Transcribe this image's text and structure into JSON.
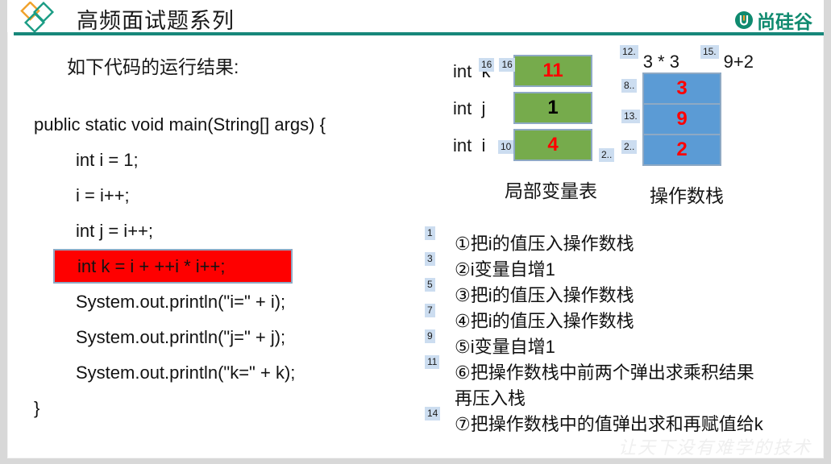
{
  "header": {
    "title": "高频面试题系列",
    "brand_text": "尚硅谷",
    "logo_icon": "diamonds-logo-icon",
    "brand_icon": "shangguigu-u-logo-icon",
    "rule_color": "#17877a",
    "brand_color": "#0f8a6f"
  },
  "left": {
    "lead": "如下代码的运行结果:",
    "code": [
      {
        "text": "public static void main(String[] args) {",
        "indent": false,
        "highlight": false
      },
      {
        "text": "int i = 1;",
        "indent": true,
        "highlight": false
      },
      {
        "text": "i = i++;",
        "indent": true,
        "highlight": false
      },
      {
        "text": "int j = i++;",
        "indent": true,
        "highlight": false
      },
      {
        "text": "int k = i + ++i * i++;",
        "indent": true,
        "highlight": true
      },
      {
        "text": "System.out.println(\"i=\" + i);",
        "indent": true,
        "highlight": false
      },
      {
        "text": "System.out.println(\"j=\" + j);",
        "indent": true,
        "highlight": false
      },
      {
        "text": "System.out.println(\"k=\" + k);",
        "indent": true,
        "highlight": false
      },
      {
        "text": "}",
        "indent": false,
        "highlight": false
      }
    ],
    "highlight_bg": "#fe0000",
    "highlight_border": "#8ea9c4"
  },
  "local_variable_table": {
    "caption": "局部变量表",
    "box_color": "#76ab4c",
    "border_color": "#8ea9c4",
    "rows": [
      {
        "type": "int",
        "name": "k",
        "badges": [
          "16",
          "16"
        ],
        "badge_style": "pair",
        "value": "11",
        "value_color": "#ff0000"
      },
      {
        "type": "int",
        "name": "j",
        "badges": [],
        "badge_style": "none",
        "value": "1",
        "value_color": "#000000"
      },
      {
        "type": "int",
        "name": "i",
        "badges": [
          "10"
        ],
        "badge_style": "single",
        "value": "4",
        "value_color": "#ff0000"
      }
    ]
  },
  "operand_stack": {
    "caption": "操作数栈",
    "box_color": "#5b9bd5",
    "border_color": "#8ea9c4",
    "top_annotations": [
      {
        "badge": "12.",
        "expr": "3 * 3"
      },
      {
        "badge": "15.",
        "expr": "9+2"
      }
    ],
    "rows": [
      {
        "badges": [
          "8.."
        ],
        "value": "3",
        "value_color": "#ff0000"
      },
      {
        "badges": [
          "13."
        ],
        "value": "9",
        "value_color": "#ff0000"
      },
      {
        "badges": [
          "2..",
          "2.."
        ],
        "value": "2",
        "value_color": "#ff0000"
      }
    ]
  },
  "steps": [
    {
      "badge": "1",
      "text": "①把i的值压入操作数栈"
    },
    {
      "badge": "3",
      "text": "②i变量自增1"
    },
    {
      "badge": "5",
      "text": "③把i的值压入操作数栈"
    },
    {
      "badge": "7",
      "text": "④把i的值压入操作数栈"
    },
    {
      "badge": "9",
      "text": "⑤i变量自增1"
    },
    {
      "badge": "11",
      "text": "⑥把操作数栈中前两个弹出求乘积结果再压入栈"
    },
    {
      "badge": "14",
      "text": "⑦把操作数栈中的值弹出求和再赋值给k"
    }
  ],
  "watermark": "让天下没有难学的技术"
}
